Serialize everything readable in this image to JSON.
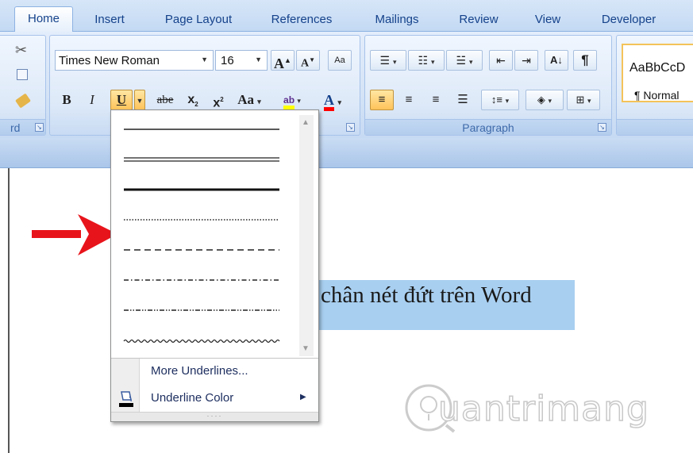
{
  "tabs": [
    "Home",
    "Insert",
    "Page Layout",
    "References",
    "Mailings",
    "Review",
    "View",
    "Developer"
  ],
  "active_tab": "Home",
  "clipboard": {
    "label_partial": "rd"
  },
  "font": {
    "name": "Times New Roman",
    "size": "16",
    "grow_label": "A",
    "shrink_label": "A",
    "bold_label": "B",
    "italic_label": "I",
    "underline_label": "U",
    "strike_label": "abe",
    "subscript_label": "x",
    "superscript_label": "x",
    "change_case_label": "Aa",
    "highlight_label": "ab",
    "font_color_label": "A",
    "highlight_color": "#ffff00",
    "font_color": "#ff0000"
  },
  "paragraph": {
    "label": "Paragraph",
    "pilcrow": "¶"
  },
  "styles": {
    "preview": "AaBbCcD",
    "normal_label": "¶ Normal"
  },
  "underline_menu": {
    "line_styles": [
      "single",
      "double",
      "thick",
      "dotted",
      "dashed",
      "dash-dot",
      "dash-dot-dot",
      "wave"
    ],
    "selected_hint": "dashed",
    "more_underlines": "More Underlines...",
    "underline_color": "Underline Color",
    "grip": "····"
  },
  "document": {
    "text_visible": "chân nét đứt trên Word"
  },
  "watermark": {
    "text": "uantrimang"
  },
  "colors": {
    "accent_arrow": "#e8141b",
    "doc_highlight": "#a8cff0"
  }
}
